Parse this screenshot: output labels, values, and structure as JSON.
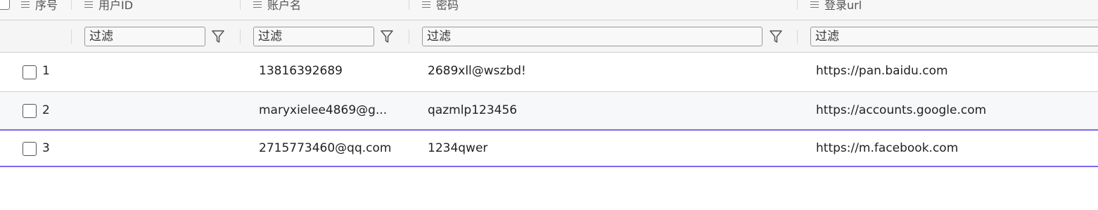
{
  "columns": [
    {
      "id": "seq",
      "label": "序号"
    },
    {
      "id": "user_id",
      "label": "用户ID"
    },
    {
      "id": "account",
      "label": "账户名"
    },
    {
      "id": "password",
      "label": "密码"
    },
    {
      "id": "login_url",
      "label": "登录url"
    }
  ],
  "filter": {
    "placeholder": "过滤"
  },
  "rows": [
    {
      "seq": "1",
      "user_id": "",
      "account": "13816392689",
      "password": "2689xll@wszbd!",
      "login_url": "https://pan.baidu.com"
    },
    {
      "seq": "2",
      "user_id": "",
      "account": "maryxielee4869@g...",
      "password": "qazmlp123456",
      "login_url": "https://accounts.google.com"
    },
    {
      "seq": "3",
      "user_id": "",
      "account": "2715773460@qq.com",
      "password": "1234qwer",
      "login_url": "https://m.facebook.com"
    }
  ],
  "colors": {
    "selection_border": "#7b68ee",
    "header_bg": "#f7f7f7",
    "row_alt_bg": "#f7f8fa"
  }
}
